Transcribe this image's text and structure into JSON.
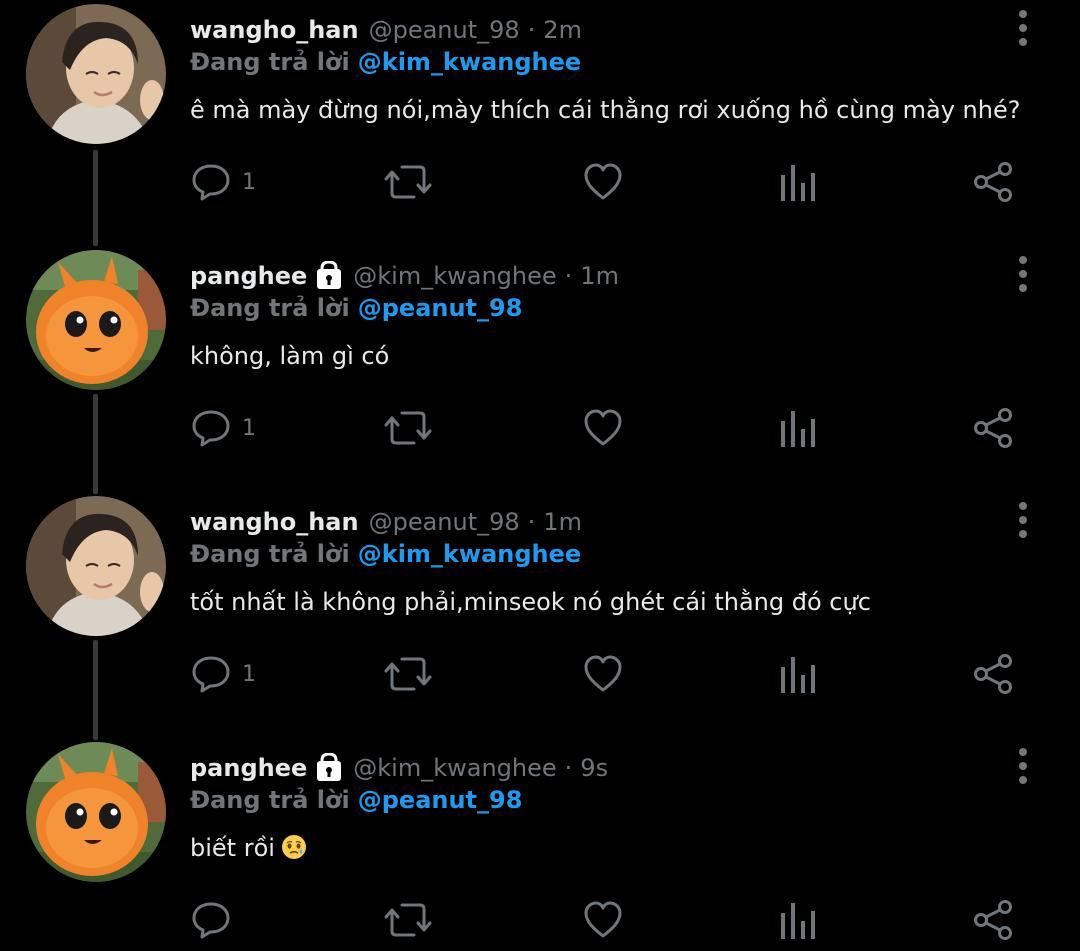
{
  "reply_prefix": "Đang trả lời",
  "tweets": [
    {
      "name": "wangho_han",
      "handle": "@peanut_98",
      "time": "2m",
      "reply_to": "@kim_kwanghee",
      "text": "ê mà mày đừng nói,mày thích cái thằng rơi xuống hồ cùng mày nhé?",
      "reply_count": "1",
      "avatar": "person-photo",
      "locked": false
    },
    {
      "name": "panghee",
      "handle": "@kim_kwanghee",
      "time": "1m",
      "reply_to": "@peanut_98",
      "text": "không, làm gì có",
      "reply_count": "1",
      "avatar": "orange-fluffy-creature",
      "locked": true
    },
    {
      "name": "wangho_han",
      "handle": "@peanut_98",
      "time": "1m",
      "reply_to": "@kim_kwanghee",
      "text": "tốt nhất là không phải,minseok nó ghét cái thằng đó cực",
      "reply_count": "1",
      "avatar": "person-photo",
      "locked": false
    },
    {
      "name": "panghee",
      "handle": "@kim_kwanghee",
      "time": "9s",
      "reply_to": "@peanut_98",
      "text": "biết rồi",
      "reply_count": "",
      "avatar": "orange-fluffy-creature",
      "locked": true,
      "emoji": "face-holding-back-tears"
    }
  ],
  "colors": {
    "background": "#000000",
    "primary_text": "#e7e9ea",
    "secondary_text": "#71767b",
    "mention": "#1d9bf0",
    "thread_line": "#3a3a3a"
  },
  "icons": [
    "reply-icon",
    "retweet-icon",
    "like-icon",
    "stats-icon",
    "share-icon",
    "more-icon",
    "lock-icon"
  ]
}
